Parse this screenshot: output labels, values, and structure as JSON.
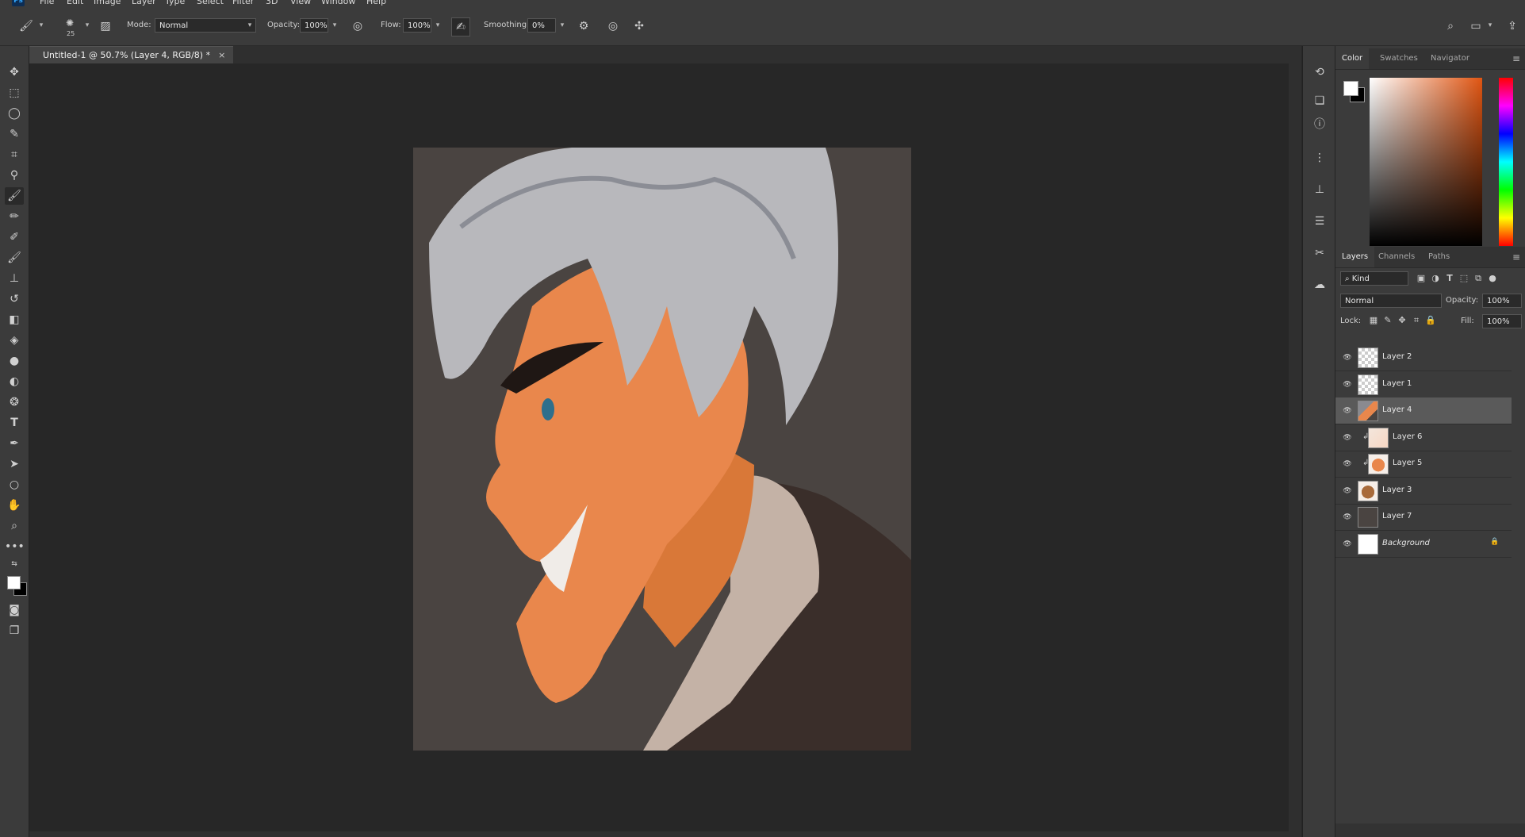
{
  "menubar": {
    "app_icon": "Ps",
    "items": [
      "File",
      "Edit",
      "Image",
      "Layer",
      "Type",
      "Select",
      "Filter",
      "3D",
      "View",
      "Window",
      "Help"
    ]
  },
  "options": {
    "brush_size": "25",
    "mode_label": "Mode:",
    "mode_value": "Normal",
    "opacity_label": "Opacity:",
    "opacity_value": "100%",
    "flow_label": "Flow:",
    "flow_value": "100%",
    "smoothing_label": "Smoothing:",
    "smoothing_value": "0%"
  },
  "document": {
    "tab_title": "Untitled-1 @ 50.7% (Layer 4, RGB/8) *",
    "close_glyph": "×"
  },
  "color_panel": {
    "tabs": [
      "Color",
      "Swatches",
      "Navigator"
    ],
    "active_tab": "Color",
    "foreground": "#ffffff",
    "background": "#000000",
    "hue_color": "#e05512"
  },
  "layers_panel": {
    "tabs": [
      "Layers",
      "Channels",
      "Paths"
    ],
    "active_tab": "Layers",
    "kind_label": "Kind",
    "blend_mode": "Normal",
    "opacity_label": "Opacity:",
    "opacity_value": "100%",
    "lock_label": "Lock:",
    "fill_label": "Fill:",
    "fill_value": "100%",
    "layers": [
      {
        "name": "Layer 2",
        "thumb": "checker",
        "selected": false,
        "clipped": false
      },
      {
        "name": "Layer 1",
        "thumb": "checker",
        "selected": false,
        "clipped": false
      },
      {
        "name": "Layer 4",
        "thumb": "portrait",
        "selected": true,
        "clipped": false
      },
      {
        "name": "Layer 6",
        "thumb": "sketch",
        "selected": false,
        "clipped": true
      },
      {
        "name": "Layer 5",
        "thumb": "orange",
        "selected": false,
        "clipped": true
      },
      {
        "name": "Layer 3",
        "thumb": "brown",
        "selected": false,
        "clipped": false
      },
      {
        "name": "Layer 7",
        "thumb": "dark",
        "selected": false,
        "clipped": false
      },
      {
        "name": "Background",
        "thumb": "white",
        "selected": false,
        "clipped": false,
        "locked": true
      }
    ]
  },
  "colors": {
    "chrome": "#3b3b3b",
    "workspace": "#272727",
    "canvas_bg": "#4a4441",
    "skin": "#e9874c",
    "hair": "#b8b8bc"
  }
}
